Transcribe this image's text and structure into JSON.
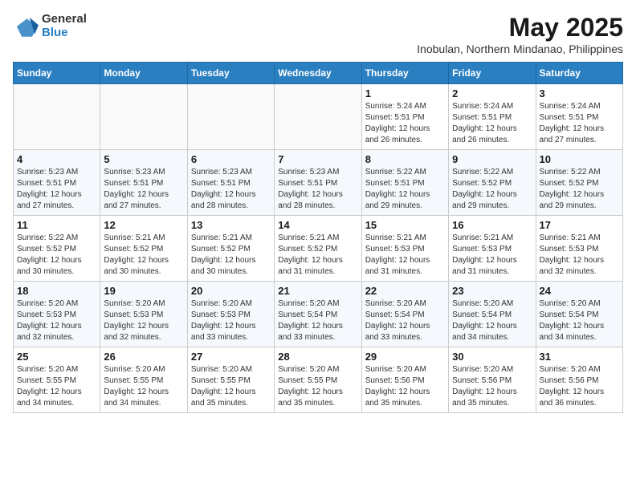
{
  "logo": {
    "general": "General",
    "blue": "Blue"
  },
  "title": {
    "month_year": "May 2025",
    "location": "Inobulan, Northern Mindanao, Philippines"
  },
  "header_days": [
    "Sunday",
    "Monday",
    "Tuesday",
    "Wednesday",
    "Thursday",
    "Friday",
    "Saturday"
  ],
  "weeks": [
    [
      {
        "day": "",
        "info": ""
      },
      {
        "day": "",
        "info": ""
      },
      {
        "day": "",
        "info": ""
      },
      {
        "day": "",
        "info": ""
      },
      {
        "day": "1",
        "info": "Sunrise: 5:24 AM\nSunset: 5:51 PM\nDaylight: 12 hours\nand 26 minutes."
      },
      {
        "day": "2",
        "info": "Sunrise: 5:24 AM\nSunset: 5:51 PM\nDaylight: 12 hours\nand 26 minutes."
      },
      {
        "day": "3",
        "info": "Sunrise: 5:24 AM\nSunset: 5:51 PM\nDaylight: 12 hours\nand 27 minutes."
      }
    ],
    [
      {
        "day": "4",
        "info": "Sunrise: 5:23 AM\nSunset: 5:51 PM\nDaylight: 12 hours\nand 27 minutes."
      },
      {
        "day": "5",
        "info": "Sunrise: 5:23 AM\nSunset: 5:51 PM\nDaylight: 12 hours\nand 27 minutes."
      },
      {
        "day": "6",
        "info": "Sunrise: 5:23 AM\nSunset: 5:51 PM\nDaylight: 12 hours\nand 28 minutes."
      },
      {
        "day": "7",
        "info": "Sunrise: 5:23 AM\nSunset: 5:51 PM\nDaylight: 12 hours\nand 28 minutes."
      },
      {
        "day": "8",
        "info": "Sunrise: 5:22 AM\nSunset: 5:51 PM\nDaylight: 12 hours\nand 29 minutes."
      },
      {
        "day": "9",
        "info": "Sunrise: 5:22 AM\nSunset: 5:52 PM\nDaylight: 12 hours\nand 29 minutes."
      },
      {
        "day": "10",
        "info": "Sunrise: 5:22 AM\nSunset: 5:52 PM\nDaylight: 12 hours\nand 29 minutes."
      }
    ],
    [
      {
        "day": "11",
        "info": "Sunrise: 5:22 AM\nSunset: 5:52 PM\nDaylight: 12 hours\nand 30 minutes."
      },
      {
        "day": "12",
        "info": "Sunrise: 5:21 AM\nSunset: 5:52 PM\nDaylight: 12 hours\nand 30 minutes."
      },
      {
        "day": "13",
        "info": "Sunrise: 5:21 AM\nSunset: 5:52 PM\nDaylight: 12 hours\nand 30 minutes."
      },
      {
        "day": "14",
        "info": "Sunrise: 5:21 AM\nSunset: 5:52 PM\nDaylight: 12 hours\nand 31 minutes."
      },
      {
        "day": "15",
        "info": "Sunrise: 5:21 AM\nSunset: 5:53 PM\nDaylight: 12 hours\nand 31 minutes."
      },
      {
        "day": "16",
        "info": "Sunrise: 5:21 AM\nSunset: 5:53 PM\nDaylight: 12 hours\nand 31 minutes."
      },
      {
        "day": "17",
        "info": "Sunrise: 5:21 AM\nSunset: 5:53 PM\nDaylight: 12 hours\nand 32 minutes."
      }
    ],
    [
      {
        "day": "18",
        "info": "Sunrise: 5:20 AM\nSunset: 5:53 PM\nDaylight: 12 hours\nand 32 minutes."
      },
      {
        "day": "19",
        "info": "Sunrise: 5:20 AM\nSunset: 5:53 PM\nDaylight: 12 hours\nand 32 minutes."
      },
      {
        "day": "20",
        "info": "Sunrise: 5:20 AM\nSunset: 5:53 PM\nDaylight: 12 hours\nand 33 minutes."
      },
      {
        "day": "21",
        "info": "Sunrise: 5:20 AM\nSunset: 5:54 PM\nDaylight: 12 hours\nand 33 minutes."
      },
      {
        "day": "22",
        "info": "Sunrise: 5:20 AM\nSunset: 5:54 PM\nDaylight: 12 hours\nand 33 minutes."
      },
      {
        "day": "23",
        "info": "Sunrise: 5:20 AM\nSunset: 5:54 PM\nDaylight: 12 hours\nand 34 minutes."
      },
      {
        "day": "24",
        "info": "Sunrise: 5:20 AM\nSunset: 5:54 PM\nDaylight: 12 hours\nand 34 minutes."
      }
    ],
    [
      {
        "day": "25",
        "info": "Sunrise: 5:20 AM\nSunset: 5:55 PM\nDaylight: 12 hours\nand 34 minutes."
      },
      {
        "day": "26",
        "info": "Sunrise: 5:20 AM\nSunset: 5:55 PM\nDaylight: 12 hours\nand 34 minutes."
      },
      {
        "day": "27",
        "info": "Sunrise: 5:20 AM\nSunset: 5:55 PM\nDaylight: 12 hours\nand 35 minutes."
      },
      {
        "day": "28",
        "info": "Sunrise: 5:20 AM\nSunset: 5:55 PM\nDaylight: 12 hours\nand 35 minutes."
      },
      {
        "day": "29",
        "info": "Sunrise: 5:20 AM\nSunset: 5:56 PM\nDaylight: 12 hours\nand 35 minutes."
      },
      {
        "day": "30",
        "info": "Sunrise: 5:20 AM\nSunset: 5:56 PM\nDaylight: 12 hours\nand 35 minutes."
      },
      {
        "day": "31",
        "info": "Sunrise: 5:20 AM\nSunset: 5:56 PM\nDaylight: 12 hours\nand 36 minutes."
      }
    ]
  ]
}
